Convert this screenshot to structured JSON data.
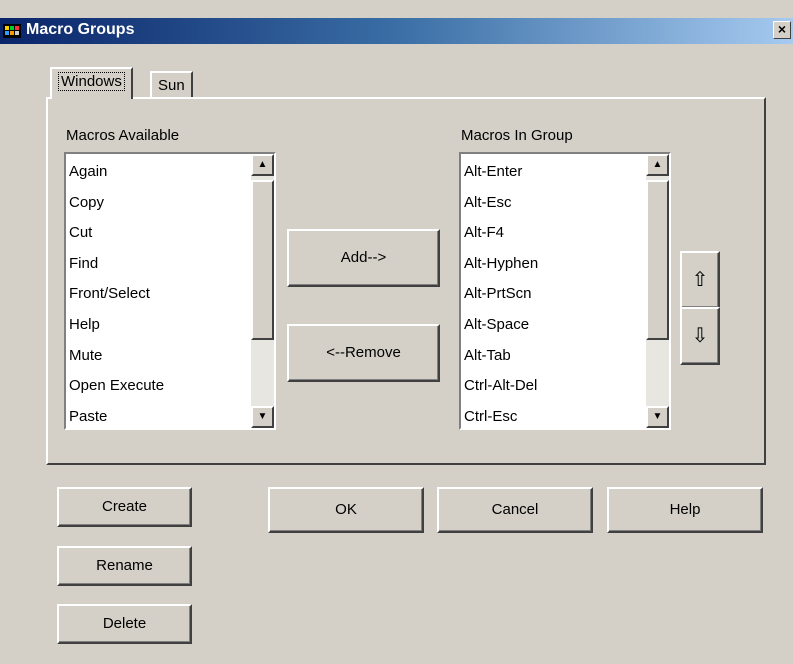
{
  "window": {
    "title": "Macro Groups",
    "close_label": "×"
  },
  "tabs": [
    {
      "label": "Windows"
    },
    {
      "label": "Sun"
    }
  ],
  "available": {
    "label": "Macros Available",
    "items": [
      "Again",
      "Copy",
      "Cut",
      "Find",
      "Front/Select",
      "Help",
      "Mute",
      "Open Execute",
      "Paste"
    ]
  },
  "group": {
    "label": "Macros In Group",
    "items": [
      "Alt-Enter",
      "Alt-Esc",
      "Alt-F4",
      "Alt-Hyphen",
      "Alt-PrtScn",
      "Alt-Space",
      "Alt-Tab",
      "Ctrl-Alt-Del",
      "Ctrl-Esc"
    ]
  },
  "buttons": {
    "add": "Add-->",
    "remove": "<--Remove",
    "move_up": "⇧",
    "move_down": "⇩",
    "create": "Create",
    "rename": "Rename",
    "delete": "Delete",
    "ok": "OK",
    "cancel": "Cancel",
    "help": "Help"
  },
  "scroll_arrows": {
    "up": "▲",
    "down": "▼"
  },
  "colors": {
    "titlebar_start": "#0a246a",
    "titlebar_end": "#a6caf0",
    "face": "#d4d0c8"
  }
}
